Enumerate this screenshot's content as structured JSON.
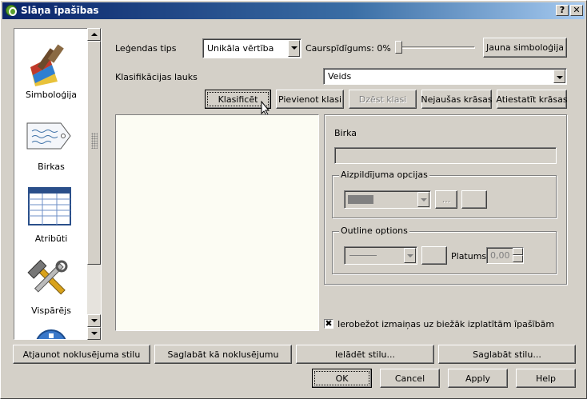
{
  "window": {
    "title": "Slāņa īpašības",
    "help_btn": "?",
    "close_btn": "✕"
  },
  "sidebar": {
    "items": [
      {
        "label": "Simboloģija",
        "icon": "paintbrush-icon"
      },
      {
        "label": "Birkas",
        "icon": "label-tag-icon"
      },
      {
        "label": "Atribūti",
        "icon": "table-icon"
      },
      {
        "label": "Vispārējs",
        "icon": "tools-icon"
      },
      {
        "label": "",
        "icon": "metadata-icon"
      }
    ]
  },
  "symbology": {
    "legend_type_label": "Leģendas tips",
    "legend_type_value": "Unikāla vērtība",
    "transparency_label": "Caurspīdīgums: 0%",
    "transparency_value": 0,
    "new_symbology_btn": "Jauna simboloģija",
    "classification_field_label": "Klasifikācijas lauks",
    "classification_field_value": "Veids",
    "classify_btn": "Klasificēt",
    "add_class_btn": "Pievienot klasi",
    "delete_class_btn": "Dzēst klasi",
    "random_colors_btn": "Nejaušas krāsas",
    "reset_colors_btn": "Atiestatīt krāsas",
    "label_caption": "Birka",
    "fill_group_title": "Aizpildījuma opcijas",
    "fill_more_btn": "...",
    "outline_group_title": "Outline options",
    "width_label": "Platums",
    "width_value": "0,00",
    "restrict_checkbox_label": "Ierobežot izmaiņas uz biežāk izplatītām īpašībām",
    "restrict_checked": true,
    "checkbox_mark": "✖"
  },
  "bottom": {
    "restore_default_btn": "Atjaunot noklusējuma stilu",
    "save_default_btn": "Saglabāt kā noklusējumu",
    "load_style_btn": "Ielādēt stilu...",
    "save_style_btn": "Saglabāt stilu...",
    "ok_btn": "OK",
    "cancel_btn": "Cancel",
    "apply_btn": "Apply",
    "help_btn": "Help"
  },
  "colors": {
    "titlebar": "#0a246a",
    "face": "#d4d0c8",
    "list_bg": "#fcfcf3"
  }
}
